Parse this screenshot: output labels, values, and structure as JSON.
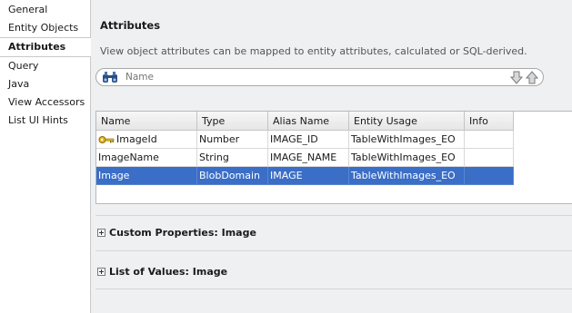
{
  "sidebar": {
    "items": [
      {
        "label": "General",
        "selected": false
      },
      {
        "label": "Entity Objects",
        "selected": false
      },
      {
        "label": "Attributes",
        "selected": true
      },
      {
        "label": "Query",
        "selected": false
      },
      {
        "label": "Java",
        "selected": false
      },
      {
        "label": "View Accessors",
        "selected": false
      },
      {
        "label": "List UI Hints",
        "selected": false
      }
    ]
  },
  "main": {
    "title": "Attributes",
    "description": "View object attributes can be mapped to entity attributes, calculated or SQL-derived.",
    "search": {
      "placeholder": "Name",
      "icon": "binoculars-icon"
    },
    "table": {
      "columns": [
        "Name",
        "Type",
        "Alias Name",
        "Entity Usage",
        "Info"
      ],
      "rows": [
        {
          "name": "ImageId",
          "type": "Number",
          "alias": "IMAGE_ID",
          "usage": "TableWithImages_EO",
          "info": "",
          "key": true,
          "selected": false
        },
        {
          "name": "ImageName",
          "type": "String",
          "alias": "IMAGE_NAME",
          "usage": "TableWithImages_EO",
          "info": "",
          "key": false,
          "selected": false
        },
        {
          "name": "Image",
          "type": "BlobDomain",
          "alias": "IMAGE",
          "usage": "TableWithImages_EO",
          "info": "",
          "key": false,
          "selected": true
        }
      ]
    },
    "sections": [
      {
        "label": "Custom Properties: Image"
      },
      {
        "label": "List of Values: Image"
      }
    ]
  },
  "colors": {
    "selection": "#3a6ec7",
    "panel": "#eef0f2"
  }
}
